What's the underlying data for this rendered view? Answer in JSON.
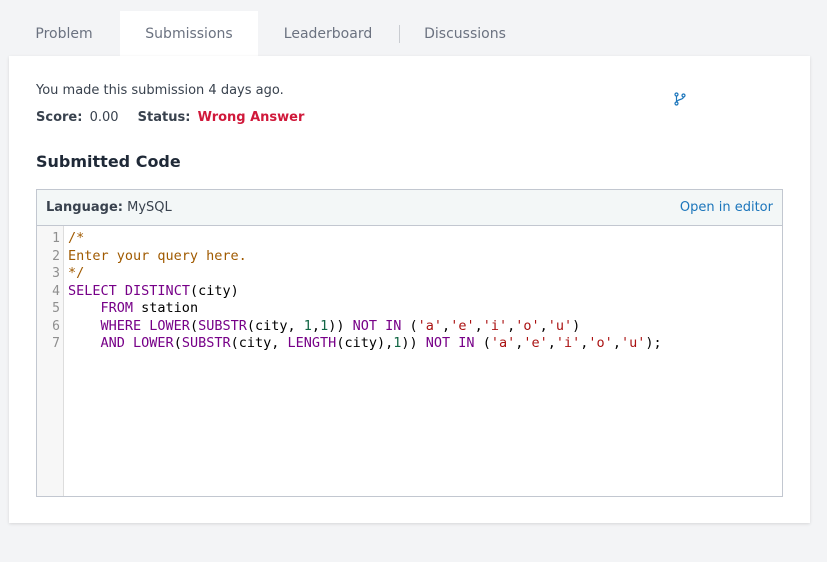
{
  "tabs": [
    {
      "label": "Problem",
      "active": false
    },
    {
      "label": "Submissions",
      "active": true
    },
    {
      "label": "Leaderboard",
      "active": false
    },
    {
      "label": "Discussions",
      "active": false
    }
  ],
  "submission": {
    "info": "You made this submission 4 days ago.",
    "score_label": "Score:",
    "score_value": "0.00",
    "status_label": "Status:",
    "status_value": "Wrong Answer"
  },
  "section_title": "Submitted Code",
  "code": {
    "language_label": "Language:",
    "language_value": "MySQL",
    "open_editor": "Open in editor",
    "line_numbers": [
      "1",
      "2",
      "3",
      "4",
      "5",
      "6",
      "7"
    ],
    "lines": [
      "/*",
      "Enter your query here.",
      "*/",
      "SELECT DISTINCT(city)",
      "    FROM station",
      "    WHERE LOWER(SUBSTR(city, 1,1)) NOT IN ('a','e','i','o','u')",
      "    AND LOWER(SUBSTR(city, LENGTH(city),1)) NOT IN ('a','e','i','o','u');"
    ]
  },
  "colors": {
    "status_wrong": "#d0183a",
    "link": "#1b75bb",
    "keyword": "#770088",
    "comment": "#a05a00",
    "string": "#aa1111",
    "number": "#116644"
  },
  "icons": {
    "branch": "git-branch-icon"
  }
}
